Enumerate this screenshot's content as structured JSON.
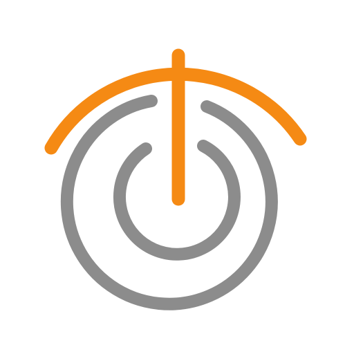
{
  "icon": {
    "name": "power-signal-logo",
    "colors": {
      "background": "#ffffff",
      "accent": "#F58A14",
      "neutral": "#8C8C8C"
    }
  }
}
